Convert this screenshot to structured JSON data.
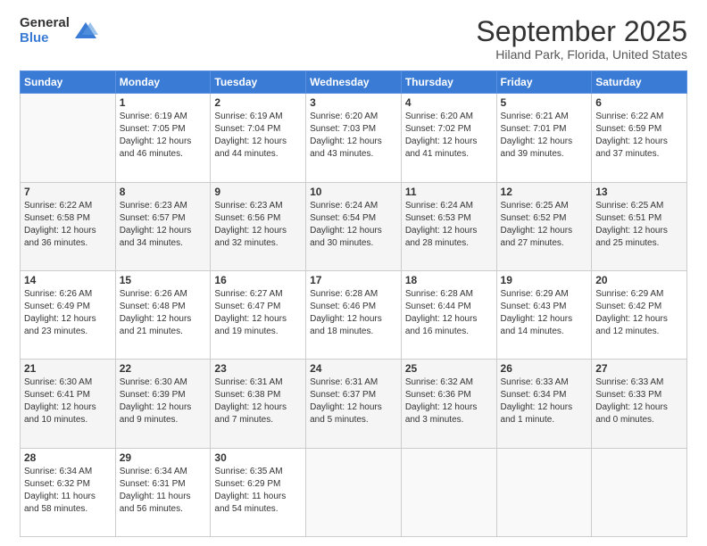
{
  "logo": {
    "general": "General",
    "blue": "Blue"
  },
  "header": {
    "title": "September 2025",
    "subtitle": "Hiland Park, Florida, United States"
  },
  "weekdays": [
    "Sunday",
    "Monday",
    "Tuesday",
    "Wednesday",
    "Thursday",
    "Friday",
    "Saturday"
  ],
  "weeks": [
    [
      {
        "day": "",
        "info": ""
      },
      {
        "day": "1",
        "info": "Sunrise: 6:19 AM\nSunset: 7:05 PM\nDaylight: 12 hours\nand 46 minutes."
      },
      {
        "day": "2",
        "info": "Sunrise: 6:19 AM\nSunset: 7:04 PM\nDaylight: 12 hours\nand 44 minutes."
      },
      {
        "day": "3",
        "info": "Sunrise: 6:20 AM\nSunset: 7:03 PM\nDaylight: 12 hours\nand 43 minutes."
      },
      {
        "day": "4",
        "info": "Sunrise: 6:20 AM\nSunset: 7:02 PM\nDaylight: 12 hours\nand 41 minutes."
      },
      {
        "day": "5",
        "info": "Sunrise: 6:21 AM\nSunset: 7:01 PM\nDaylight: 12 hours\nand 39 minutes."
      },
      {
        "day": "6",
        "info": "Sunrise: 6:22 AM\nSunset: 6:59 PM\nDaylight: 12 hours\nand 37 minutes."
      }
    ],
    [
      {
        "day": "7",
        "info": "Sunrise: 6:22 AM\nSunset: 6:58 PM\nDaylight: 12 hours\nand 36 minutes."
      },
      {
        "day": "8",
        "info": "Sunrise: 6:23 AM\nSunset: 6:57 PM\nDaylight: 12 hours\nand 34 minutes."
      },
      {
        "day": "9",
        "info": "Sunrise: 6:23 AM\nSunset: 6:56 PM\nDaylight: 12 hours\nand 32 minutes."
      },
      {
        "day": "10",
        "info": "Sunrise: 6:24 AM\nSunset: 6:54 PM\nDaylight: 12 hours\nand 30 minutes."
      },
      {
        "day": "11",
        "info": "Sunrise: 6:24 AM\nSunset: 6:53 PM\nDaylight: 12 hours\nand 28 minutes."
      },
      {
        "day": "12",
        "info": "Sunrise: 6:25 AM\nSunset: 6:52 PM\nDaylight: 12 hours\nand 27 minutes."
      },
      {
        "day": "13",
        "info": "Sunrise: 6:25 AM\nSunset: 6:51 PM\nDaylight: 12 hours\nand 25 minutes."
      }
    ],
    [
      {
        "day": "14",
        "info": "Sunrise: 6:26 AM\nSunset: 6:49 PM\nDaylight: 12 hours\nand 23 minutes."
      },
      {
        "day": "15",
        "info": "Sunrise: 6:26 AM\nSunset: 6:48 PM\nDaylight: 12 hours\nand 21 minutes."
      },
      {
        "day": "16",
        "info": "Sunrise: 6:27 AM\nSunset: 6:47 PM\nDaylight: 12 hours\nand 19 minutes."
      },
      {
        "day": "17",
        "info": "Sunrise: 6:28 AM\nSunset: 6:46 PM\nDaylight: 12 hours\nand 18 minutes."
      },
      {
        "day": "18",
        "info": "Sunrise: 6:28 AM\nSunset: 6:44 PM\nDaylight: 12 hours\nand 16 minutes."
      },
      {
        "day": "19",
        "info": "Sunrise: 6:29 AM\nSunset: 6:43 PM\nDaylight: 12 hours\nand 14 minutes."
      },
      {
        "day": "20",
        "info": "Sunrise: 6:29 AM\nSunset: 6:42 PM\nDaylight: 12 hours\nand 12 minutes."
      }
    ],
    [
      {
        "day": "21",
        "info": "Sunrise: 6:30 AM\nSunset: 6:41 PM\nDaylight: 12 hours\nand 10 minutes."
      },
      {
        "day": "22",
        "info": "Sunrise: 6:30 AM\nSunset: 6:39 PM\nDaylight: 12 hours\nand 9 minutes."
      },
      {
        "day": "23",
        "info": "Sunrise: 6:31 AM\nSunset: 6:38 PM\nDaylight: 12 hours\nand 7 minutes."
      },
      {
        "day": "24",
        "info": "Sunrise: 6:31 AM\nSunset: 6:37 PM\nDaylight: 12 hours\nand 5 minutes."
      },
      {
        "day": "25",
        "info": "Sunrise: 6:32 AM\nSunset: 6:36 PM\nDaylight: 12 hours\nand 3 minutes."
      },
      {
        "day": "26",
        "info": "Sunrise: 6:33 AM\nSunset: 6:34 PM\nDaylight: 12 hours\nand 1 minute."
      },
      {
        "day": "27",
        "info": "Sunrise: 6:33 AM\nSunset: 6:33 PM\nDaylight: 12 hours\nand 0 minutes."
      }
    ],
    [
      {
        "day": "28",
        "info": "Sunrise: 6:34 AM\nSunset: 6:32 PM\nDaylight: 11 hours\nand 58 minutes."
      },
      {
        "day": "29",
        "info": "Sunrise: 6:34 AM\nSunset: 6:31 PM\nDaylight: 11 hours\nand 56 minutes."
      },
      {
        "day": "30",
        "info": "Sunrise: 6:35 AM\nSunset: 6:29 PM\nDaylight: 11 hours\nand 54 minutes."
      },
      {
        "day": "",
        "info": ""
      },
      {
        "day": "",
        "info": ""
      },
      {
        "day": "",
        "info": ""
      },
      {
        "day": "",
        "info": ""
      }
    ]
  ]
}
